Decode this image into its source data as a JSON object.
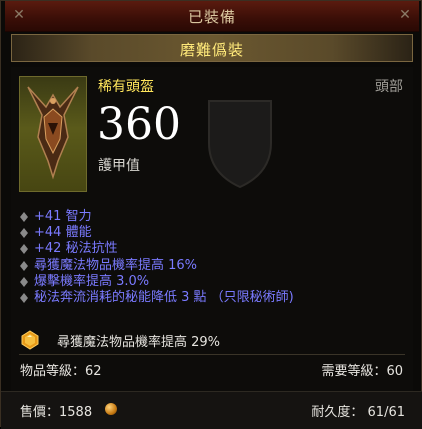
{
  "header": {
    "equipped_label": "已裝備"
  },
  "item": {
    "name": "磨難僞裝",
    "rarity": "稀有頭盔",
    "slot": "頭部",
    "armor": "360",
    "armor_label": "護甲值",
    "affixes": [
      "+41 智力",
      "+44 體能",
      "+42 秘法抗性",
      "尋獲魔法物品機率提高 16%",
      "爆擊機率提高 3.0%",
      "秘法奔流消耗的秘能降低 3 點 （只限秘術師)"
    ],
    "socket_text": "尋獲魔法物品機率提高 29%",
    "item_level": "物品等級：62",
    "required_level": "需要等級：60",
    "price": "售價：1588",
    "durability": "耐久度： 61/61"
  },
  "colors": {
    "magic_affix": "#7a7aff",
    "rare_yellow": "#ffe65c",
    "title_gold": "#ffe97a"
  },
  "icons": {
    "portrait": "helm-icon",
    "socket_gem": "topaz-gem-icon",
    "currency": "gold-coin-icon",
    "bullet": "diamond-bullet-icon"
  }
}
